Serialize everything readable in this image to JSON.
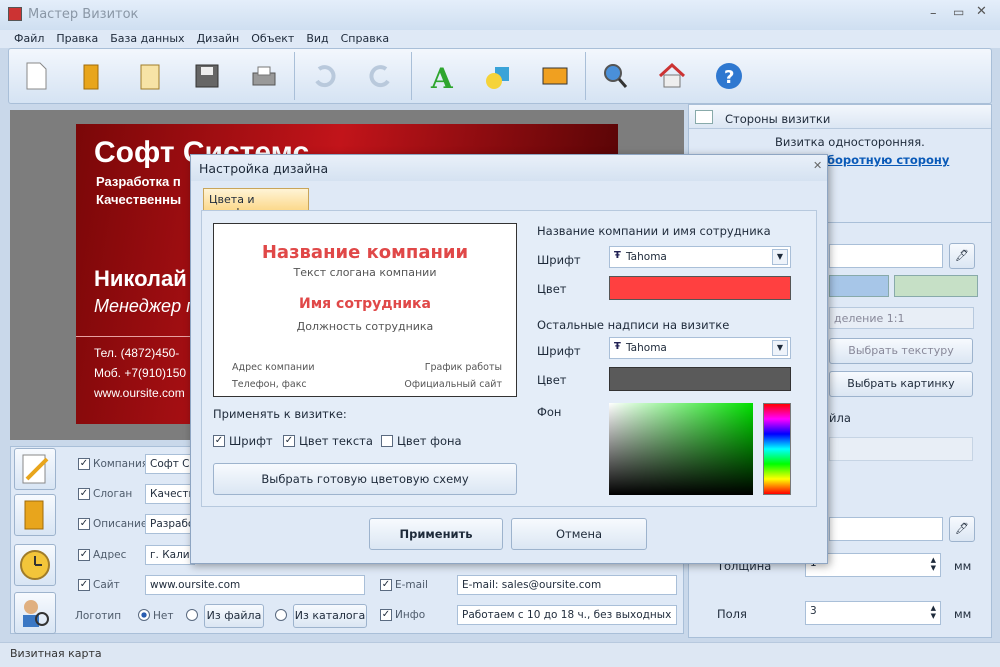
{
  "window": {
    "title": "Мастер Визиток"
  },
  "menu": [
    "Файл",
    "Правка",
    "База данных",
    "Дизайн",
    "Объект",
    "Вид",
    "Справка"
  ],
  "card": {
    "company": "Софт Системс",
    "line1": "Разработка п",
    "line2": "Качественны",
    "name": "Николай",
    "position": "Менеджер п",
    "phone": "Тел. (4872)450-",
    "mobile": "Моб. +7(910)150",
    "web": "www.oursite.com"
  },
  "fields": {
    "company_label": "Компания",
    "company_value": "Софт Си",
    "slogan_label": "Слоган",
    "slogan_value": "Качеств",
    "desc_label": "Описание",
    "desc_value": "Разрабо",
    "address_label": "Адрес",
    "address_value": "г. Калин",
    "site_label": "Сайт",
    "site_value": "www.oursite.com",
    "email_label": "E-mail",
    "email_value": "E-mail: sales@oursite.com",
    "logo_label": "Логотип",
    "logo_none": "Нет",
    "from_file": "Из файла",
    "from_catalog": "Из каталога",
    "info_label": "Инфо",
    "info_value": "Работаем с 10 до 18 ч., без выходных"
  },
  "right": {
    "sides_title": "Стороны визитки",
    "sides_text": "Визитка односторонняя.",
    "sides_link": "боротную сторону",
    "scale_text": "деление 1:1",
    "choose_texture": "Выбрать текстуру",
    "choose_picture": "Выбрать картинку",
    "file_frag": "йла",
    "thickness_label": "Толщина",
    "thickness_value": "1",
    "unit": "мм",
    "margin_label": "Поля",
    "margin_value": "3",
    "unit2": "мм"
  },
  "status": "Визитная карта",
  "dialog": {
    "title": "Настройка дизайна",
    "tab": "Цвета и шрифты",
    "preview": {
      "company": "Название компании",
      "slogan": "Текст слогана компании",
      "employee": "Имя сотрудника",
      "position": "Должность сотрудника",
      "address": "Адрес компании",
      "schedule": "График работы",
      "phone": "Телефон, факс",
      "site": "Официальный сайт"
    },
    "apply_to": "Применять к визитке:",
    "chk_font": "Шрифт",
    "chk_textcolor": "Цвет текста",
    "chk_bg": "Цвет фона",
    "scheme_btn": "Выбрать готовую цветовую схему",
    "section1": "Название компании и имя сотрудника",
    "font_label": "Шрифт",
    "font1": "Tahoma",
    "color_label": "Цвет",
    "section2": "Остальные надписи на визитке",
    "font_label2": "Шрифт",
    "font2": "Tahoma",
    "color_label2": "Цвет",
    "bg_label": "Фон",
    "apply_btn": "Применить",
    "cancel_btn": "Отмена",
    "colors": {
      "color1": "#ff4040",
      "color2": "#5a5a5a"
    }
  }
}
